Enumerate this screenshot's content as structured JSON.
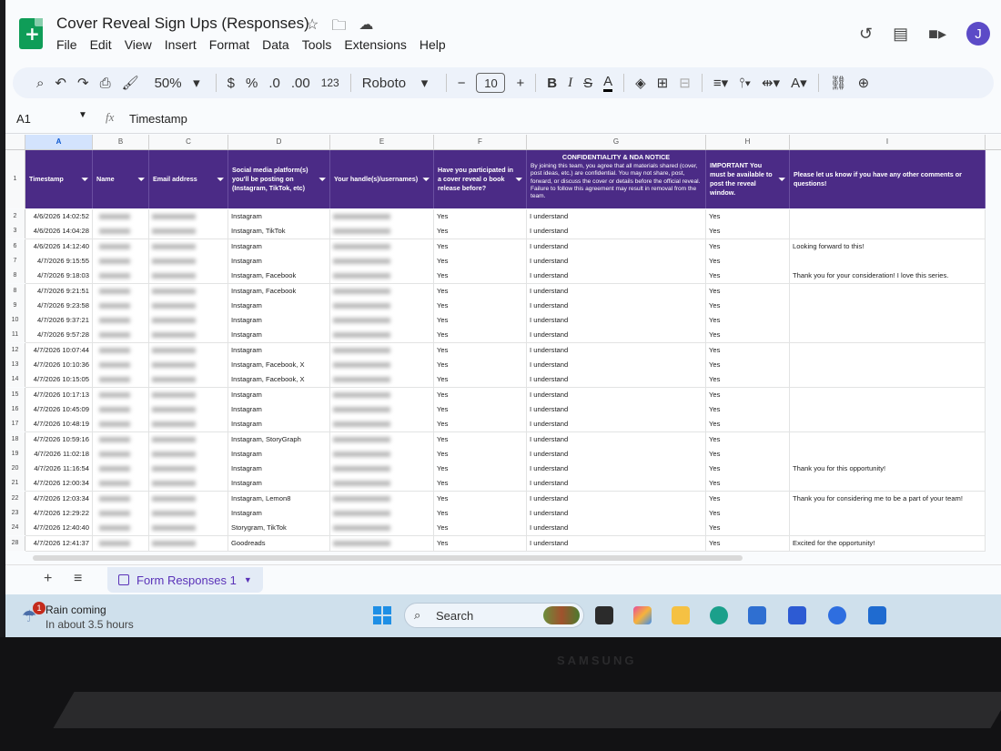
{
  "app": {
    "doc_title": "Cover Reveal Sign Ups (Responses)",
    "menu": [
      "File",
      "Edit",
      "View",
      "Insert",
      "Format",
      "Data",
      "Tools",
      "Extensions",
      "Help"
    ],
    "avatar_letter": "J"
  },
  "toolbar": {
    "zoom": "50%",
    "currency": "$",
    "percent": "%",
    "dec_decrease": ".0",
    "dec_increase": ".00",
    "number_format": "123",
    "font": "Roboto",
    "font_size": "10"
  },
  "formula_bar": {
    "cell_ref": "A1",
    "fx": "fx",
    "value": "Timestamp"
  },
  "columns": [
    "A",
    "B",
    "C",
    "D",
    "E",
    "F",
    "G",
    "H",
    "I"
  ],
  "headers": {
    "timestamp": "Timestamp",
    "name": "Name",
    "email": "Email address",
    "platforms": "Social media platform(s) you'll be posting on (Instagram, TikTok, etc)",
    "handles": "Your handle(s)/usernames)",
    "participated": "Have you participated in a cover reveal o book release before?",
    "nda_title": "CONFIDENTIALITY & NDA NOTICE",
    "nda_body": "By joining this team, you agree that all materials shared (cover, post ideas, etc.) are confidential. You may not share, post, forward, or discuss the cover or details before the official reveal. Failure to follow this agreement may result in removal from the team.",
    "important": "IMPORTANT You must be available to post the reveal window.",
    "comments": "Please let us know if you have any other comments or questions!"
  },
  "row_header_first": "1",
  "rows": [
    {
      "n": "2",
      "ts": "4/6/2026 14:02:52",
      "platform": "Instagram",
      "participated": "Yes",
      "nda": "I understand",
      "important": "Yes",
      "comment": ""
    },
    {
      "n": "3",
      "ts": "4/6/2026 14:04:28",
      "platform": "Instagram, TikTok",
      "participated": "Yes",
      "nda": "I understand",
      "important": "Yes",
      "comment": ""
    },
    {
      "n": "6",
      "ts": "4/6/2026 14:12:40",
      "platform": "Instagram",
      "participated": "Yes",
      "nda": "I understand",
      "important": "Yes",
      "comment": "Looking forward to this!"
    },
    {
      "n": "7",
      "ts": "4/7/2026 9:15:55",
      "platform": "Instagram",
      "participated": "Yes",
      "nda": "I understand",
      "important": "Yes",
      "comment": ""
    },
    {
      "n": "8",
      "ts": "4/7/2026 9:18:03",
      "platform": "Instagram, Facebook",
      "participated": "Yes",
      "nda": "I understand",
      "important": "Yes",
      "comment": "Thank you for your consideration! I love this series."
    },
    {
      "n": "8",
      "ts": "4/7/2026 9:21:51",
      "platform": "Instagram, Facebook",
      "participated": "Yes",
      "nda": "I understand",
      "important": "Yes",
      "comment": ""
    },
    {
      "n": "9",
      "ts": "4/7/2026 9:23:58",
      "platform": "Instagram",
      "participated": "Yes",
      "nda": "I understand",
      "important": "Yes",
      "comment": ""
    },
    {
      "n": "10",
      "ts": "4/7/2026 9:37:21",
      "platform": "Instagram",
      "participated": "Yes",
      "nda": "I understand",
      "important": "Yes",
      "comment": ""
    },
    {
      "n": "11",
      "ts": "4/7/2026 9:57:28",
      "platform": "Instagram",
      "participated": "Yes",
      "nda": "I understand",
      "important": "Yes",
      "comment": ""
    },
    {
      "n": "12",
      "ts": "4/7/2026 10:07:44",
      "platform": "Instagram",
      "participated": "Yes",
      "nda": "I understand",
      "important": "Yes",
      "comment": ""
    },
    {
      "n": "13",
      "ts": "4/7/2026 10:10:36",
      "platform": "Instagram, Facebook, X",
      "participated": "Yes",
      "nda": "I understand",
      "important": "Yes",
      "comment": ""
    },
    {
      "n": "14",
      "ts": "4/7/2026 10:15:05",
      "platform": "Instagram, Facebook, X",
      "participated": "Yes",
      "nda": "I understand",
      "important": "Yes",
      "comment": ""
    },
    {
      "n": "15",
      "ts": "4/7/2026 10:17:13",
      "platform": "Instagram",
      "participated": "Yes",
      "nda": "I understand",
      "important": "Yes",
      "comment": ""
    },
    {
      "n": "16",
      "ts": "4/7/2026 10:45:09",
      "platform": "Instagram",
      "participated": "Yes",
      "nda": "I understand",
      "important": "Yes",
      "comment": ""
    },
    {
      "n": "17",
      "ts": "4/7/2026 10:48:19",
      "platform": "Instagram",
      "participated": "Yes",
      "nda": "I understand",
      "important": "Yes",
      "comment": ""
    },
    {
      "n": "18",
      "ts": "4/7/2026 10:59:16",
      "platform": "Instagram, StoryGraph",
      "participated": "Yes",
      "nda": "I understand",
      "important": "Yes",
      "comment": ""
    },
    {
      "n": "19",
      "ts": "4/7/2026 11:02:18",
      "platform": "Instagram",
      "participated": "Yes",
      "nda": "I understand",
      "important": "Yes",
      "comment": ""
    },
    {
      "n": "20",
      "ts": "4/7/2026 11:16:54",
      "platform": "Instagram",
      "participated": "Yes",
      "nda": "I understand",
      "important": "Yes",
      "comment": "Thank you for this opportunity!"
    },
    {
      "n": "21",
      "ts": "4/7/2026 12:00:34",
      "platform": "Instagram",
      "participated": "Yes",
      "nda": "I understand",
      "important": "Yes",
      "comment": ""
    },
    {
      "n": "22",
      "ts": "4/7/2026 12:03:34",
      "platform": "Instagram, Lemon8",
      "participated": "Yes",
      "nda": "I understand",
      "important": "Yes",
      "comment": "Thank you for considering me to be a part of your team!"
    },
    {
      "n": "23",
      "ts": "4/7/2026 12:29:22",
      "platform": "Instagram",
      "participated": "Yes",
      "nda": "I understand",
      "important": "Yes",
      "comment": ""
    },
    {
      "n": "24",
      "ts": "4/7/2026 12:40:40",
      "platform": "Storygram, TikTok",
      "participated": "Yes",
      "nda": "I understand",
      "important": "Yes",
      "comment": ""
    },
    {
      "n": "28",
      "ts": "4/7/2026 12:41:37",
      "platform": "Goodreads",
      "participated": "Yes",
      "nda": "I understand",
      "important": "Yes",
      "comment": "Excited for the opportunity!"
    }
  ],
  "sheet_tab": "Form Responses 1",
  "taskbar": {
    "weather_badge": "1",
    "weather_line1": "Rain coming",
    "weather_line2": "In about 3.5 hours",
    "search": "Search"
  },
  "bezel_brand": "SAMSUNG",
  "colors": {
    "header_bg": "#4b2b86",
    "sheet_tab": "#5a32b8",
    "logo": "#0f9d58"
  },
  "icons": [
    "search-icon",
    "undo-icon",
    "redo-icon",
    "print-icon",
    "paint-format-icon",
    "star-icon",
    "folder-move-icon",
    "cloud-icon",
    "history-icon",
    "comment-icon",
    "video-icon",
    "filter-icon",
    "windows-icon"
  ]
}
